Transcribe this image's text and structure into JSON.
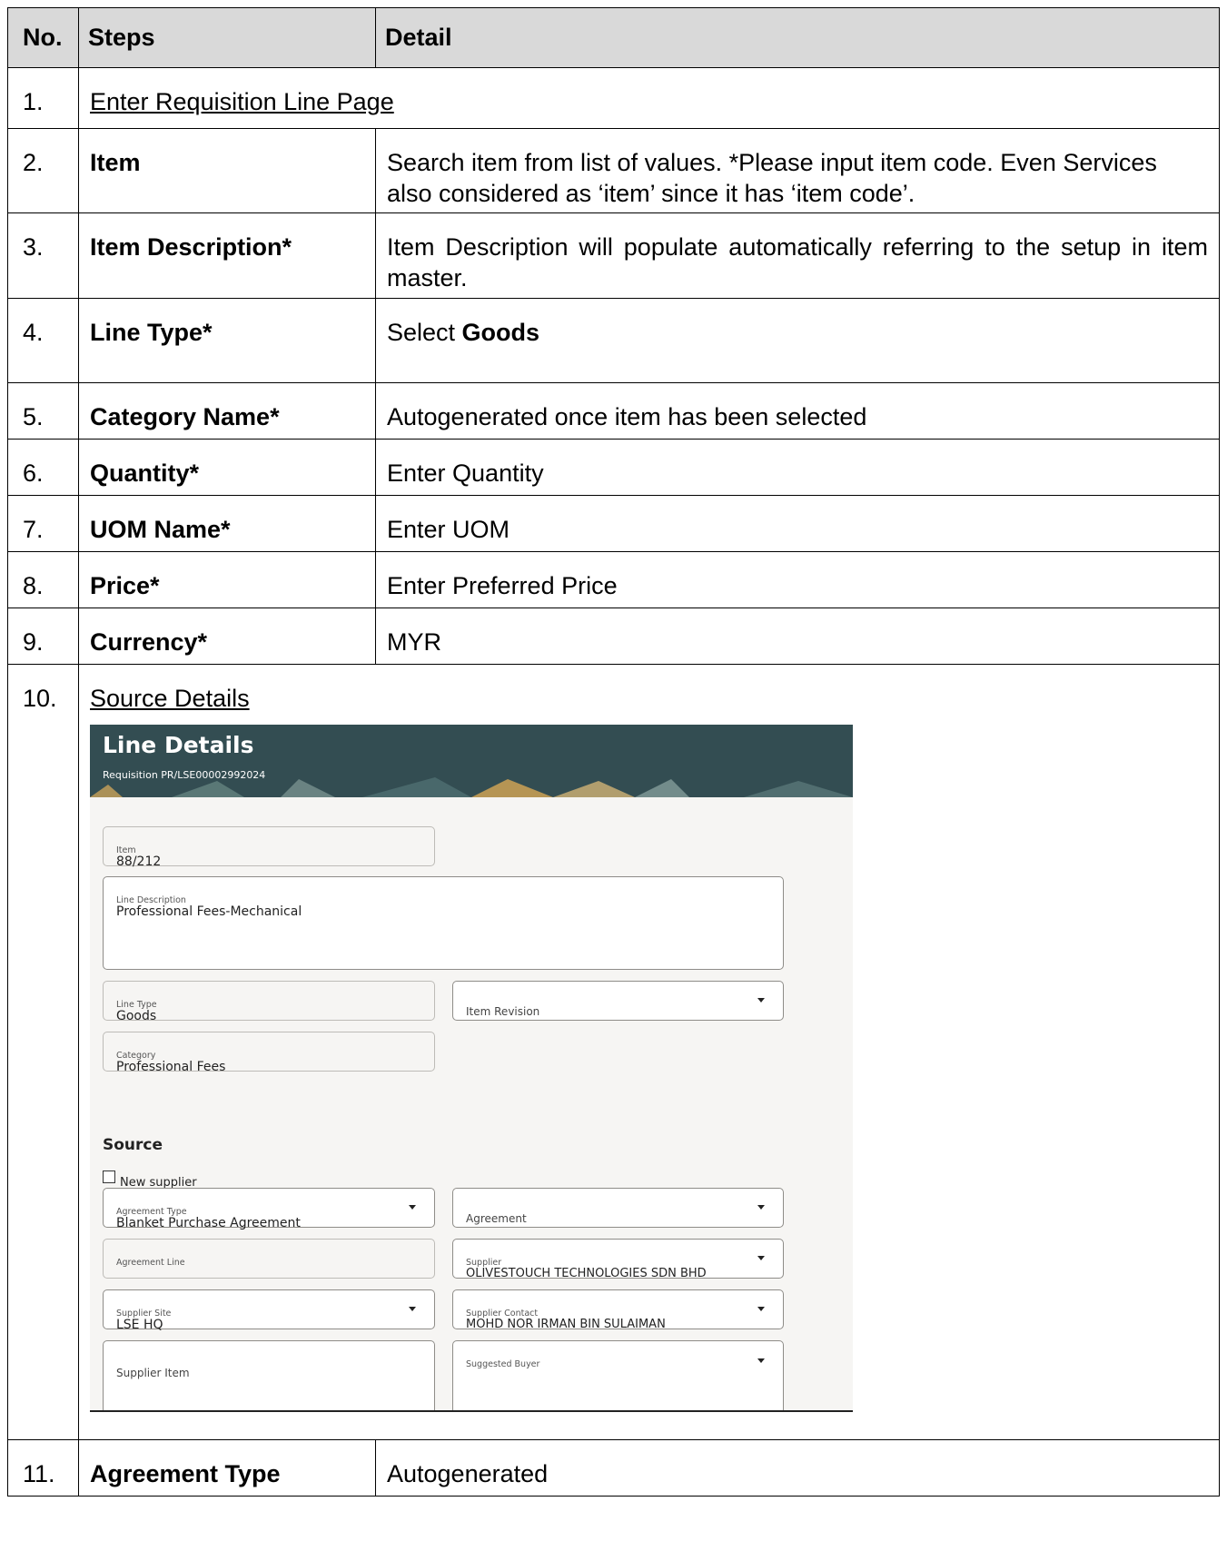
{
  "table": {
    "headers": {
      "no": "No.",
      "steps": "Steps",
      "detail": "Detail"
    },
    "rows": [
      {
        "no": "1.",
        "link": "Enter Requisition Line Page"
      },
      {
        "no": "2.",
        "step": "Item",
        "detail": "Search item from list of values. *Please input item code. Even Services also considered as ‘item’ since it has ‘item code’."
      },
      {
        "no": "3.",
        "step": "Item Description*",
        "detail": "Item Description will populate automatically referring to the setup in item master."
      },
      {
        "no": "4.",
        "step": "Line Type*",
        "detail_prefix": "Select ",
        "detail_bold": "Goods"
      },
      {
        "no": "5.",
        "step": "Category Name*",
        "detail": "Autogenerated once item has been selected"
      },
      {
        "no": "6.",
        "step": "Quantity*",
        "detail": "Enter Quantity"
      },
      {
        "no": "7.",
        "step": "UOM Name*",
        "detail": "Enter UOM"
      },
      {
        "no": "8.",
        "step": "Price*",
        "detail": "Enter Preferred Price"
      },
      {
        "no": "9.",
        "step": "Currency*",
        "detail": "MYR"
      },
      {
        "no": "10.",
        "link": "Source Details"
      },
      {
        "no": "11.",
        "step": "Agreement Type",
        "detail": "Autogenerated"
      }
    ]
  },
  "screenshot": {
    "title": "Line Details",
    "subtitle": "Requisition PR/LSE00002992024",
    "item": {
      "label": "Item",
      "value": "88/212"
    },
    "line_description": {
      "label": "Line Description",
      "value": "Professional Fees-Mechanical"
    },
    "line_type": {
      "label": "Line Type",
      "value": "Goods"
    },
    "item_revision": {
      "label": "Item Revision"
    },
    "category": {
      "label": "Category",
      "value": "Professional Fees"
    },
    "source_heading": "Source",
    "new_supplier": {
      "label": "New supplier",
      "checked": false
    },
    "agreement_type": {
      "label": "Agreement Type",
      "value": "Blanket Purchase Agreement"
    },
    "agreement": {
      "label": "Agreement"
    },
    "agreement_line": {
      "label": "Agreement Line"
    },
    "supplier": {
      "label": "Supplier",
      "value": "OLIVESTOUCH TECHNOLOGIES SDN BHD"
    },
    "supplier_site": {
      "label": "Supplier Site",
      "value": "LSE HQ"
    },
    "supplier_contact": {
      "label": "Supplier Contact",
      "value": "MOHD NOR IRMAN BIN SULAIMAN"
    },
    "supplier_item": {
      "label": "Supplier Item"
    },
    "suggested_buyer": {
      "label": "Suggested Buyer"
    }
  }
}
